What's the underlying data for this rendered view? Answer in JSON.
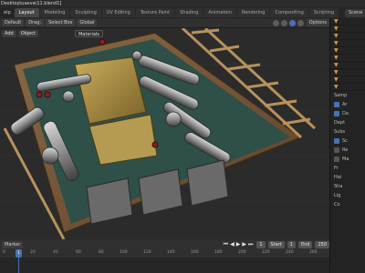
{
  "window": {
    "title": "Desktop\\uaeva\\11.blend1]"
  },
  "menubar": {
    "items": [
      "elp"
    ],
    "workspaces": [
      {
        "label": "Layout",
        "active": true
      },
      {
        "label": "Modeling",
        "active": false
      },
      {
        "label": "Sculpting",
        "active": false
      },
      {
        "label": "UV Editing",
        "active": false
      },
      {
        "label": "Texture Paint",
        "active": false
      },
      {
        "label": "Shading",
        "active": false
      },
      {
        "label": "Animation",
        "active": false
      },
      {
        "label": "Rendering",
        "active": false
      },
      {
        "label": "Compositing",
        "active": false
      },
      {
        "label": "Scripting",
        "active": false
      }
    ],
    "scene": "Scene"
  },
  "viewport_header": {
    "mode": "Default",
    "drag": "Drag:",
    "select": "Select Box",
    "orientation": "Global",
    "options": "Options"
  },
  "tool_header": {
    "add": "Add",
    "object": "Object",
    "material": "Materials"
  },
  "right_panel": {
    "prop_labels": [
      "Samp",
      "Ar",
      "Da",
      "Dept",
      "Subs",
      "Sc",
      "Re",
      "Ma",
      "Fr",
      "Hai",
      "Sha",
      "Lig",
      "Co"
    ]
  },
  "timeline": {
    "marker": "Marker",
    "current_frame": "1",
    "start_label": "Start",
    "start": "1",
    "end_label": "End",
    "end": "250",
    "ticks": [
      "0",
      "20",
      "40",
      "60",
      "80",
      "100",
      "120",
      "140",
      "160",
      "180",
      "200",
      "220",
      "240",
      "260"
    ],
    "cursor": "1"
  },
  "colors": {
    "accent": "#4772b3",
    "wood": "#7d5a3a",
    "teal": "#3f6b63",
    "brass": "#a5893f"
  }
}
